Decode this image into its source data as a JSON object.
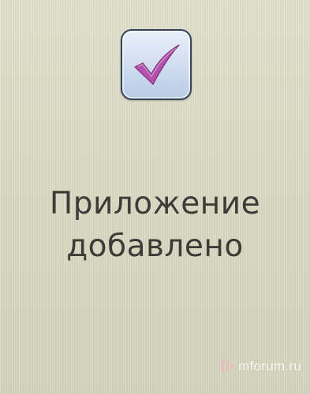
{
  "dialog": {
    "icon": "checkmark-icon",
    "message_line1": "Приложение",
    "message_line2": "добавлено"
  },
  "watermark": {
    "text": "mforum.ru"
  },
  "colors": {
    "background": "#dcdcc6",
    "text": "#3b3b38",
    "icon_frame": "#33435a",
    "icon_fill": "#cfdcef",
    "checkmark": "#b64fb0"
  }
}
